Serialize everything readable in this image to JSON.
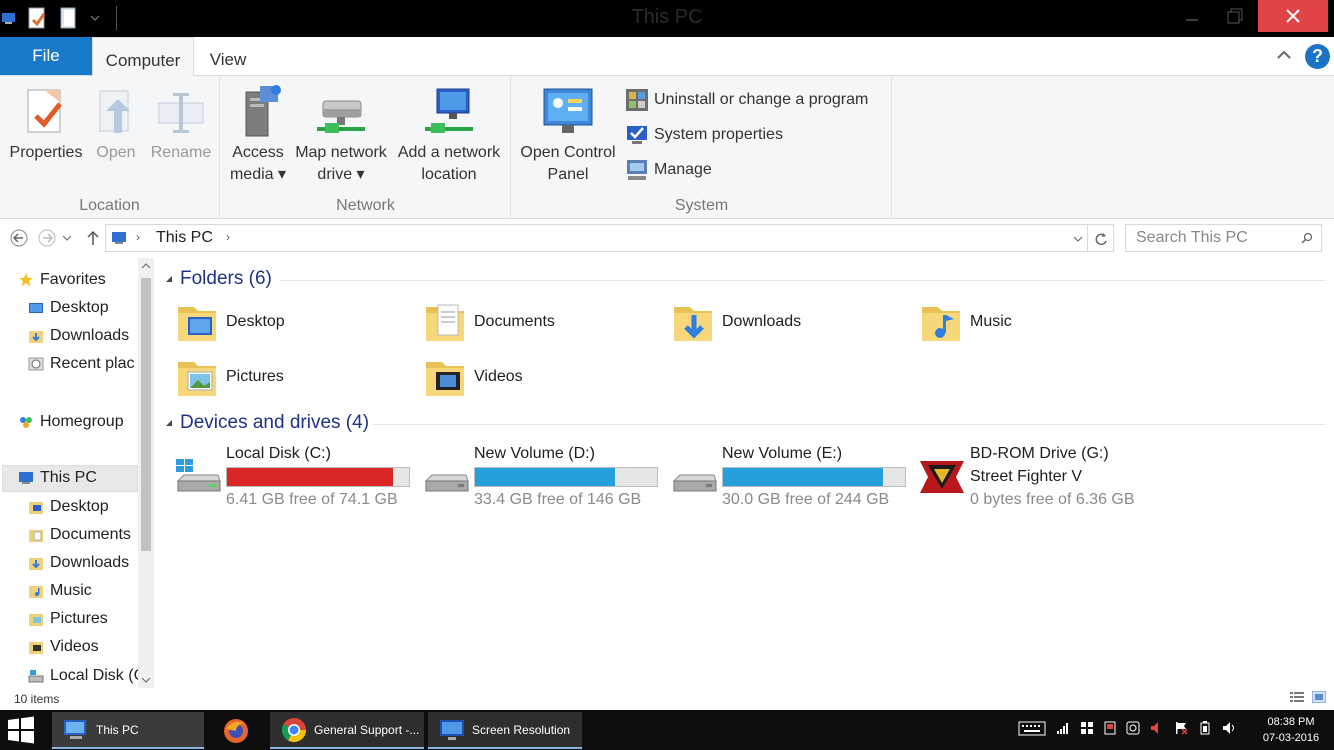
{
  "window": {
    "title": "This PC"
  },
  "ribbon": {
    "tabs": {
      "file": "File",
      "computer": "Computer",
      "view": "View"
    },
    "help": "?",
    "groups": {
      "location": {
        "label": "Location",
        "properties": "Properties",
        "open": "Open",
        "rename": "Rename"
      },
      "network": {
        "label": "Network",
        "access_media_1": "Access",
        "access_media_2": "media ▾",
        "map_drive_1": "Map network",
        "map_drive_2": "drive ▾",
        "add_location_1": "Add a network",
        "add_location_2": "location"
      },
      "system": {
        "label": "System",
        "control_panel_1": "Open Control",
        "control_panel_2": "Panel",
        "uninstall": "Uninstall or change a program",
        "system_properties": "System properties",
        "manage": "Manage"
      }
    }
  },
  "address": {
    "crumb": "This PC",
    "search_placeholder": "Search This PC"
  },
  "nav": {
    "favorites": "Favorites",
    "fav_desktop": "Desktop",
    "fav_downloads": "Downloads",
    "fav_recent": "Recent plac",
    "homegroup": "Homegroup",
    "this_pc": "This PC",
    "pc_desktop": "Desktop",
    "pc_documents": "Documents",
    "pc_downloads": "Downloads",
    "pc_music": "Music",
    "pc_pictures": "Pictures",
    "pc_videos": "Videos",
    "pc_local_disk": "Local Disk (C"
  },
  "content": {
    "folders_title": "Folders (6)",
    "folders": [
      "Desktop",
      "Documents",
      "Downloads",
      "Music",
      "Pictures",
      "Videos"
    ],
    "devices_title": "Devices and drives (4)",
    "drives": [
      {
        "name": "Local Disk (C:)",
        "free": "6.41 GB free of 74.1 GB",
        "used_fraction": 0.914,
        "color": "#da2626"
      },
      {
        "name": "New Volume (D:)",
        "free": "33.4 GB free of 146 GB",
        "used_fraction": 0.771,
        "color": "#26a0da"
      },
      {
        "name": "New Volume (E:)",
        "free": "30.0 GB free of 244 GB",
        "used_fraction": 0.877,
        "color": "#26a0da"
      },
      {
        "name": "BD-ROM Drive (G:)",
        "label": "Street Fighter V",
        "free": "0 bytes free of 6.36 GB"
      }
    ]
  },
  "status": {
    "items": "10 items"
  },
  "taskbar": {
    "this_pc": "This PC",
    "chrome": "General Support -...",
    "screen_res": "Screen Resolution",
    "time": "08:38 PM",
    "date": "07-03-2016"
  }
}
